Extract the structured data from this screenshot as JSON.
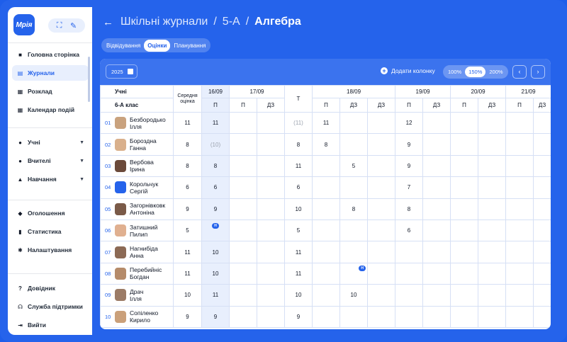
{
  "app": {
    "logo": "Мрія"
  },
  "sidebar": {
    "group1": [
      {
        "label": "Головна сторінка",
        "icon": "home-icon"
      },
      {
        "label": "Журнали",
        "icon": "journal-icon",
        "active": true
      },
      {
        "label": "Розклад",
        "icon": "calendar-icon"
      },
      {
        "label": "Календар подій",
        "icon": "calendar-events-icon"
      }
    ],
    "group2": [
      {
        "label": "Учні",
        "icon": "students-icon"
      },
      {
        "label": "Вчителі",
        "icon": "teachers-icon"
      },
      {
        "label": "Навчання",
        "icon": "education-icon"
      }
    ],
    "group3": [
      {
        "label": "Оголошення",
        "icon": "announcement-icon"
      },
      {
        "label": "Статистика",
        "icon": "stats-icon"
      },
      {
        "label": "Налаштування",
        "icon": "settings-icon"
      }
    ],
    "group4": [
      {
        "label": "Довідник",
        "icon": "help-icon"
      },
      {
        "label": "Служба підтримки",
        "icon": "support-icon"
      },
      {
        "label": "Вийти",
        "icon": "logout-icon"
      }
    ]
  },
  "breadcrumb": {
    "root": "Шкільні журнали",
    "class": "5-А",
    "current": "Алгебра"
  },
  "tabs": [
    {
      "label": "Відвідування"
    },
    {
      "label": "Оцінки",
      "active": true
    },
    {
      "label": "Планування"
    }
  ],
  "toolbar": {
    "year": "2025",
    "add_column": "Додати колонку",
    "zoom": [
      "100%",
      "150%",
      "200%"
    ],
    "zoom_active": "150%",
    "prev": "‹",
    "next": "›"
  },
  "table": {
    "students_header": "Учні",
    "class_label": "6-А клас",
    "avg_header": "Середня оцінка",
    "dates": [
      "16/09",
      "17/09",
      "",
      "18/09",
      "19/09",
      "20/09",
      "21/09"
    ],
    "subheaders": [
      "П",
      "П",
      "ДЗ",
      "Т",
      "П",
      "ДЗ",
      "ДЗ",
      "П",
      "ДЗ",
      "П",
      "ДЗ",
      "П",
      "ДЗ"
    ],
    "badge": "Н",
    "rows": [
      {
        "num": "01",
        "first": "Безбородько",
        "last": "Ілля",
        "avg": "11",
        "cells": [
          "11",
          "",
          "",
          "(11)",
          "11",
          "",
          "",
          "12",
          "",
          "",
          "",
          "",
          ""
        ]
      },
      {
        "num": "02",
        "first": "Бороздна",
        "last": "Ганна",
        "avg": "8",
        "cells": [
          "(10)",
          "",
          "",
          "8",
          "8",
          "",
          "",
          "9",
          "",
          "",
          "",
          "",
          ""
        ]
      },
      {
        "num": "03",
        "first": "Вербова",
        "last": "Ірина",
        "avg": "8",
        "cells": [
          "8",
          "",
          "",
          "11",
          "",
          "5",
          "",
          "9",
          "",
          "",
          "",
          "",
          ""
        ]
      },
      {
        "num": "04",
        "first": "Корольчук",
        "last": "Сергій",
        "avg": "6",
        "cells": [
          "6",
          "",
          "",
          "6",
          "",
          "",
          "",
          "7",
          "",
          "",
          "",
          "",
          ""
        ]
      },
      {
        "num": "05",
        "first": "Загорнівковк",
        "last": "Антоніна",
        "avg": "9",
        "cells": [
          "9",
          "",
          "",
          "10",
          "",
          "8",
          "",
          "8",
          "",
          "",
          "",
          "",
          ""
        ]
      },
      {
        "num": "06",
        "first": "Затишний",
        "last": "Пилип",
        "avg": "5",
        "cells": [
          "",
          "",
          "",
          "5",
          "",
          "",
          "",
          "6",
          "",
          "",
          "",
          "",
          ""
        ]
      },
      {
        "num": "07",
        "first": "Нагнибіда",
        "last": "Анна",
        "avg": "11",
        "cells": [
          "10",
          "",
          "",
          "11",
          "",
          "",
          "",
          "",
          "",
          "",
          "",
          "",
          ""
        ]
      },
      {
        "num": "08",
        "first": "Перебийніс",
        "last": "Богдан",
        "avg": "11",
        "cells": [
          "10",
          "",
          "",
          "11",
          "",
          "",
          "",
          "",
          "",
          "",
          "",
          "",
          ""
        ]
      },
      {
        "num": "09",
        "first": "Драч",
        "last": "Ілля",
        "avg": "10",
        "cells": [
          "11",
          "",
          "",
          "10",
          "",
          "10",
          "",
          "",
          "",
          "",
          "",
          "",
          ""
        ]
      },
      {
        "num": "10",
        "first": "Сопіленко",
        "last": "Кирило",
        "avg": "9",
        "cells": [
          "9",
          "",
          "",
          "9",
          "",
          "",
          "",
          "",
          "",
          "",
          "",
          "",
          ""
        ]
      }
    ]
  },
  "colors": {
    "accent": "#2563eb",
    "highlight": "#e8effd"
  }
}
